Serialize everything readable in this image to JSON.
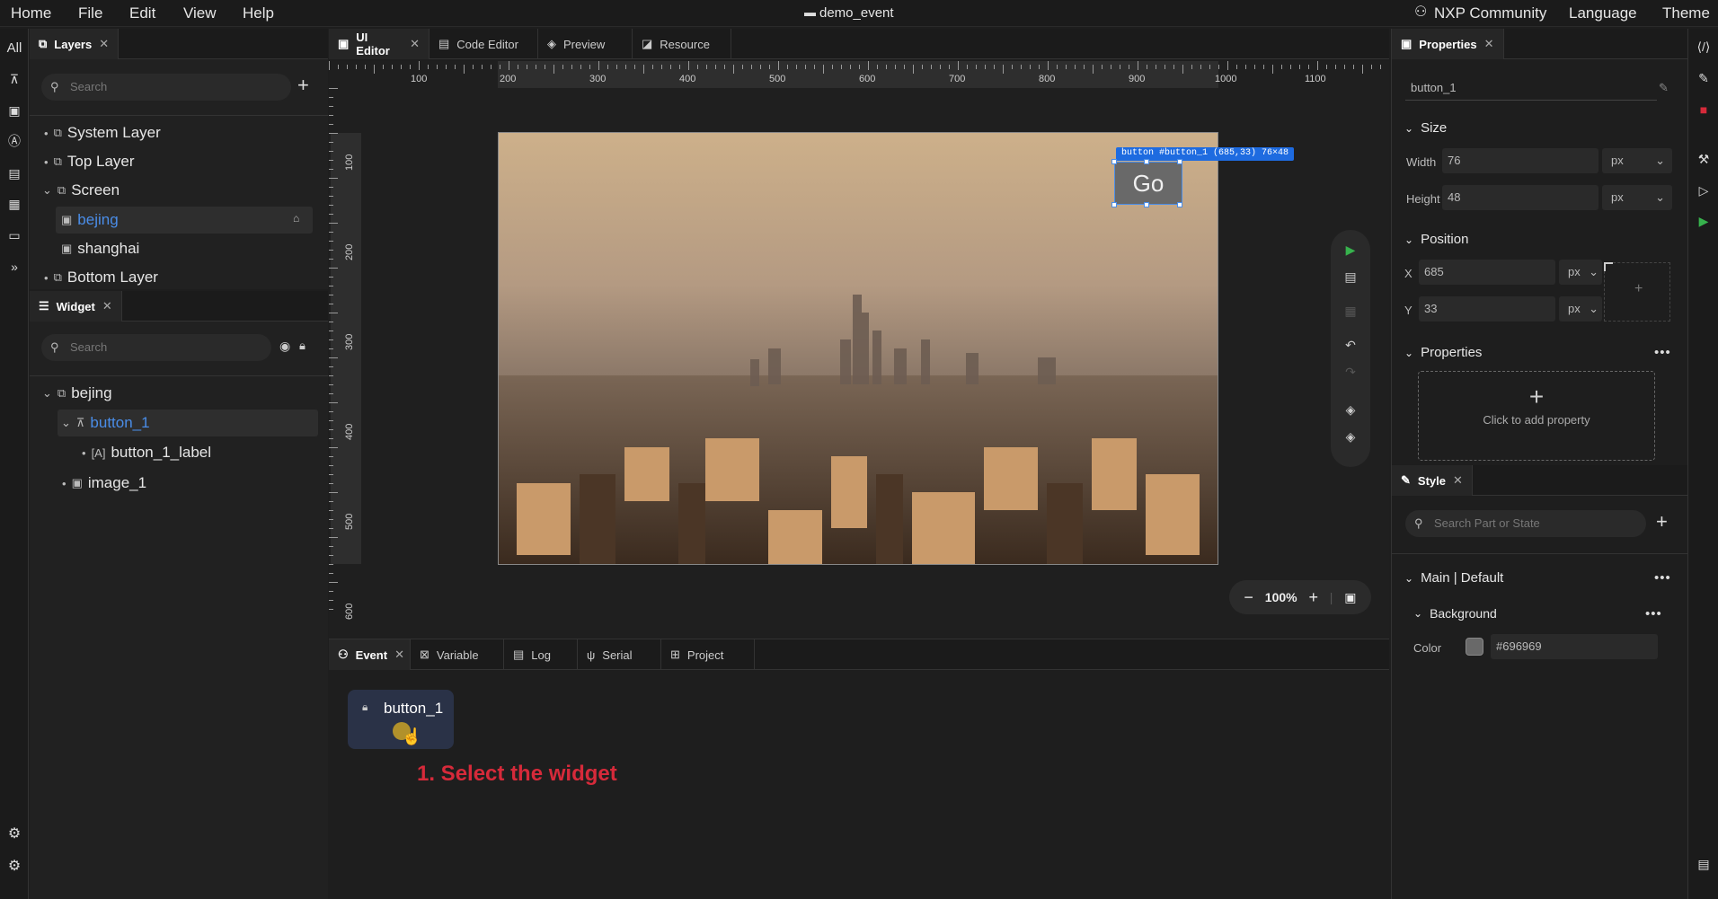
{
  "menubar": {
    "items": [
      "Home",
      "File",
      "Edit",
      "View",
      "Help"
    ],
    "project": "demo_event",
    "right": [
      "NXP Community",
      "Language",
      "Theme"
    ]
  },
  "rail": {
    "all_label": "All"
  },
  "layers_panel": {
    "tab_label": "Layers",
    "search_placeholder": "Search",
    "items": [
      {
        "label": "System Layer"
      },
      {
        "label": "Top Layer"
      },
      {
        "label": "Screen"
      },
      {
        "label": "bejing"
      },
      {
        "label": "shanghai"
      },
      {
        "label": "Bottom Layer"
      }
    ]
  },
  "widget_panel": {
    "tab_label": "Widget",
    "search_placeholder": "Search",
    "items": [
      {
        "label": "bejing"
      },
      {
        "label": "button_1"
      },
      {
        "label": "button_1_label"
      },
      {
        "label": "image_1"
      }
    ]
  },
  "editor_tabs": [
    "UI Editor",
    "Code Editor",
    "Preview",
    "Resource"
  ],
  "ruler": {
    "top": [
      "100",
      "200",
      "300",
      "400",
      "500",
      "600",
      "700",
      "800",
      "900",
      "1000",
      "1100"
    ],
    "left": [
      "100",
      "200",
      "300",
      "400",
      "500",
      "600"
    ]
  },
  "canvas": {
    "button_text": "Go",
    "selection_tag": "button #button_1 (685,33) 76×48",
    "zoom": "100%"
  },
  "bottom_tabs": [
    "Event",
    "Variable",
    "Log",
    "Serial",
    "Project"
  ],
  "event_node": {
    "label": "button_1"
  },
  "annotation": "1. Select the widget",
  "properties": {
    "tab_label": "Properties",
    "name_value": "button_1",
    "size_section": "Size",
    "width_label": "Width",
    "width_value": "76",
    "width_unit": "px",
    "height_label": "Height",
    "height_value": "48",
    "height_unit": "px",
    "position_section": "Position",
    "x_label": "X",
    "x_value": "685",
    "x_unit": "px",
    "y_label": "Y",
    "y_value": "33",
    "y_unit": "px",
    "properties_section": "Properties",
    "add_property": "Click to add property"
  },
  "style": {
    "tab_label": "Style",
    "search_placeholder": "Search Part or State",
    "part_state": "Main | Default",
    "background_section": "Background",
    "color_label": "Color",
    "color_value": "#696969"
  },
  "colors": {
    "accent": "#4a8de8",
    "button_bg": "#696969",
    "annotation": "#d62a3a"
  }
}
